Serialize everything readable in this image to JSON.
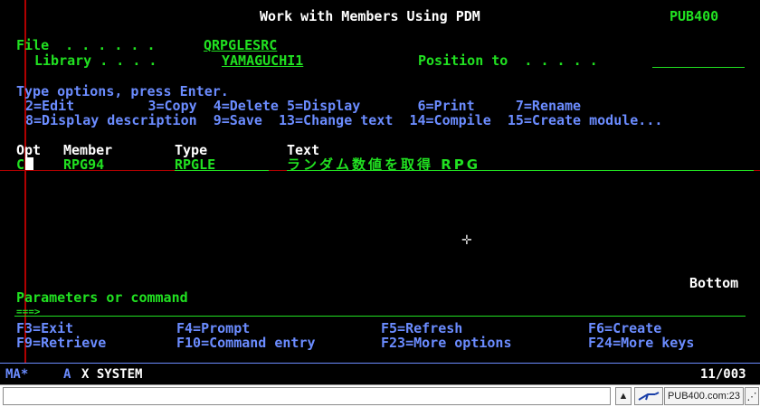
{
  "header": {
    "title": "Work with Members Using PDM",
    "system": "PUB400"
  },
  "file_info": {
    "file_label": "File  . . . . . .",
    "file_value": "QRPGLESRC",
    "library_label": "Library . . . .",
    "library_value": "YAMAGUCHI1",
    "position_label": "Position to  . . . . .",
    "position_value": ""
  },
  "instructions": {
    "heading": "Type options, press Enter.",
    "line1": "2=Edit         3=Copy  4=Delete 5=Display       6=Print     7=Rename",
    "line2": "8=Display description  9=Save  13=Change text  14=Compile  15=Create module..."
  },
  "columns": {
    "opt": "Opt",
    "member": "Member",
    "type": "Type",
    "text": "Text"
  },
  "rows": [
    {
      "opt": "C",
      "member": "RPG94",
      "type": "RPGLE",
      "text": "ランダム数値を取得 RPG"
    }
  ],
  "bottom_label": "Bottom",
  "command": {
    "label": "Parameters or command",
    "prompt": "===>",
    "value": ""
  },
  "function_keys": [
    {
      "label": "F3=Exit"
    },
    {
      "label": "F4=Prompt"
    },
    {
      "label": "F5=Refresh"
    },
    {
      "label": "F6=Create"
    },
    {
      "label": "F9=Retrieve"
    },
    {
      "label": "F10=Command entry"
    },
    {
      "label": "F23=More options"
    },
    {
      "label": "F24=More keys"
    }
  ],
  "status": {
    "left": "MA*",
    "mode": "A",
    "indicator": "X SYSTEM",
    "cursor_pos": "11/003"
  },
  "bottombar": {
    "host": "PUB400.com:23"
  },
  "icons": {
    "crosshair": "plus-cursor-icon",
    "connect": "connect-icon",
    "scroll_up": "scroll-up-icon"
  },
  "colors": {
    "background": "#000000",
    "field_green": "#21e121",
    "instruction_blue": "#6b8cff",
    "text_white": "#ffffff",
    "crosshair_red": "#b00000"
  }
}
